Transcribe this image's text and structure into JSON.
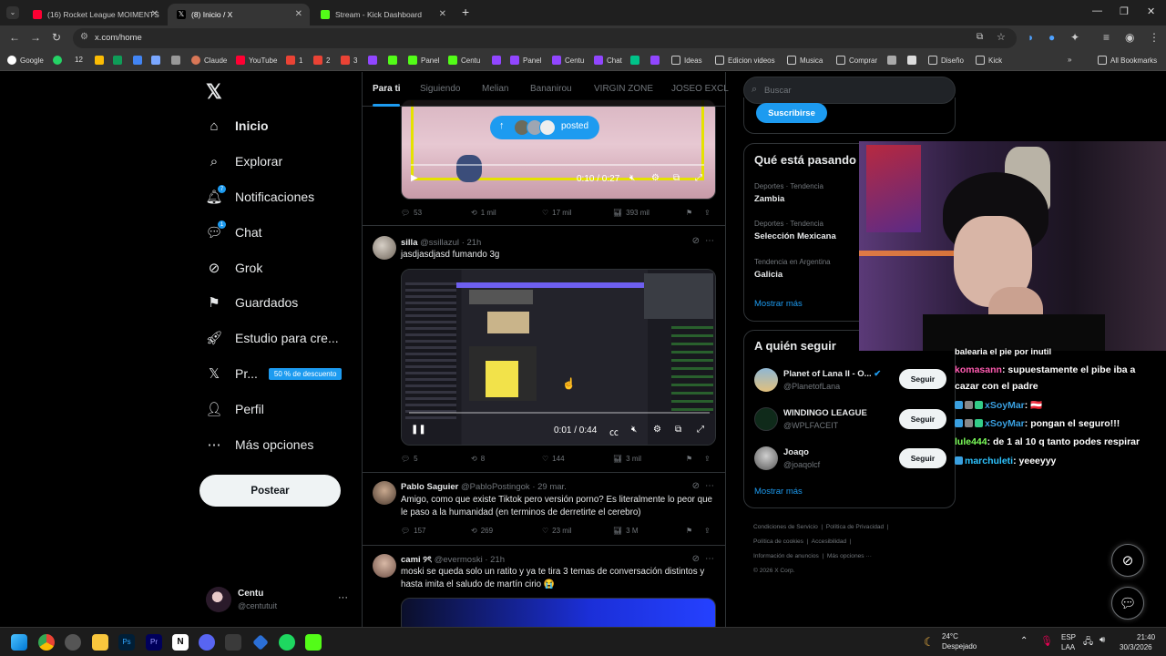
{
  "browser": {
    "tabs": [
      {
        "title": "(16) Rocket League MOIMENTS",
        "color": "#ff0033"
      },
      {
        "title": "(8) Inicio / X",
        "color": "#ffffff"
      },
      {
        "title": "Stream - Kick Dashboard",
        "color": "#53fc18"
      }
    ],
    "new_tab": "+",
    "url": "x.com/home",
    "bookmarks": [
      "Google",
      "12",
      "Claude",
      "YouTube",
      "1",
      "2",
      "3",
      "Panel",
      "Centu",
      "Panel",
      "Centu",
      "Chat",
      "Ideas",
      "Edicion videos",
      "Musica",
      "Comprar",
      "Diseño",
      "Kick"
    ],
    "all_bookmarks": "All Bookmarks"
  },
  "nav": {
    "items": [
      {
        "label": "Inicio",
        "icon": "home-icon"
      },
      {
        "label": "Explorar",
        "icon": "search-icon"
      },
      {
        "label": "Notificaciones",
        "icon": "bell-icon",
        "badge": "7"
      },
      {
        "label": "Chat",
        "icon": "chat-icon",
        "badge": "1"
      },
      {
        "label": "Grok",
        "icon": "grok-icon"
      },
      {
        "label": "Guardados",
        "icon": "bookmark-icon"
      },
      {
        "label": "Estudio para cre...",
        "icon": "rocket-icon"
      },
      {
        "label": "Pr...",
        "icon": "x-premium-icon",
        "promo": "50 % de descuento"
      },
      {
        "label": "Perfil",
        "icon": "person-icon"
      },
      {
        "label": "Más opciones",
        "icon": "more-icon"
      }
    ],
    "post_button": "Postear",
    "account": {
      "name": "Centu",
      "handle": "@centutuit",
      "more": "···"
    }
  },
  "timeline": {
    "tabs": [
      "Para ti",
      "Siguiendo",
      "Melian",
      "Bananirou",
      "VIRGIN ZONE",
      "JOSEO EXCL"
    ],
    "posted_pill": "posted",
    "tweets": [
      {
        "video_time": "0:10 / 0:27",
        "replies": "53",
        "reposts": "1 mil",
        "likes": "17 mil",
        "views": "393 mil"
      },
      {
        "name": "silla",
        "handle": "@ssillazul",
        "time": "· 21h",
        "text": "jasdjasdjasd fumando 3g",
        "video_time": "0:01 / 0:44",
        "replies": "5",
        "reposts": "8",
        "likes": "144",
        "views": "3 mil"
      },
      {
        "name": "Pablo Saguier",
        "handle": "@PabloPostingok",
        "time": "· 29 mar.",
        "text": "Amigo, como que existe Tiktok pero versión porno? Es literalmente lo peor que le paso a la humanidad (en terminos de derretirte el cerebro)",
        "replies": "157",
        "reposts": "269",
        "likes": "23 mil",
        "views": "3 M"
      },
      {
        "name": "cami ୨ৎ",
        "handle": "@evermoski",
        "time": "· 21h",
        "text": "moski se queda solo un ratito y ya te tira 3 temas de conversación distintos y hasta imita el saludo de martín cirio 😭"
      }
    ]
  },
  "right": {
    "search_placeholder": "Buscar",
    "subscribe": "Suscribirse",
    "trends_title": "Qué está pasando",
    "trends": [
      {
        "category": "Deportes · Tendencia",
        "name": "Zambia"
      },
      {
        "category": "Deportes · Tendencia",
        "name": "Selección Mexicana"
      },
      {
        "category": "Tendencia en Argentina",
        "name": "Galicia"
      }
    ],
    "show_more": "Mostrar más",
    "follow_title": "A quién seguir",
    "follow": [
      {
        "name": "Planet of Lana II - O...",
        "handle": "@PlanetofLana",
        "button": "Seguir"
      },
      {
        "name": "WINDINGO LEAGUE",
        "handle": "@WPLFACEIT",
        "button": "Seguir"
      },
      {
        "name": "Joaqo",
        "handle": "@joaqolcf",
        "button": "Seguir"
      }
    ],
    "footer": [
      "Condiciones de Servicio",
      "Política de Privacidad",
      "Política de cookies",
      "Accesibilidad",
      "Información de anuncios",
      "Más opciones ···",
      "© 2026 X Corp."
    ]
  },
  "stream_chat": [
    {
      "user": "",
      "text": "balearia el pie por inutil"
    },
    {
      "user": "komasann",
      "text": ": supuestamente el pibe iba a",
      "color": "#ff5bb0"
    },
    {
      "user": "",
      "text": "cazar con el padre"
    },
    {
      "user": "xSoyMar",
      "text": ": 🇦🇹",
      "color": "#3aa0e0"
    },
    {
      "user": "xSoyMar",
      "text": ": pongan el seguro!!!",
      "color": "#3aa0e0"
    },
    {
      "user": "lule444",
      "text": ": de 1 al 10 q tanto podes respirar",
      "color": "#7cff5a"
    },
    {
      "user": "marchuleti",
      "text": ": yeeeyyy",
      "color": "#2ec4ff"
    }
  ],
  "taskbar": {
    "weather_temp": "24°C",
    "weather_desc": "Despejado",
    "lang1": "ESP",
    "lang2": "LAA",
    "time": "21:40",
    "date": "30/3/2026"
  }
}
